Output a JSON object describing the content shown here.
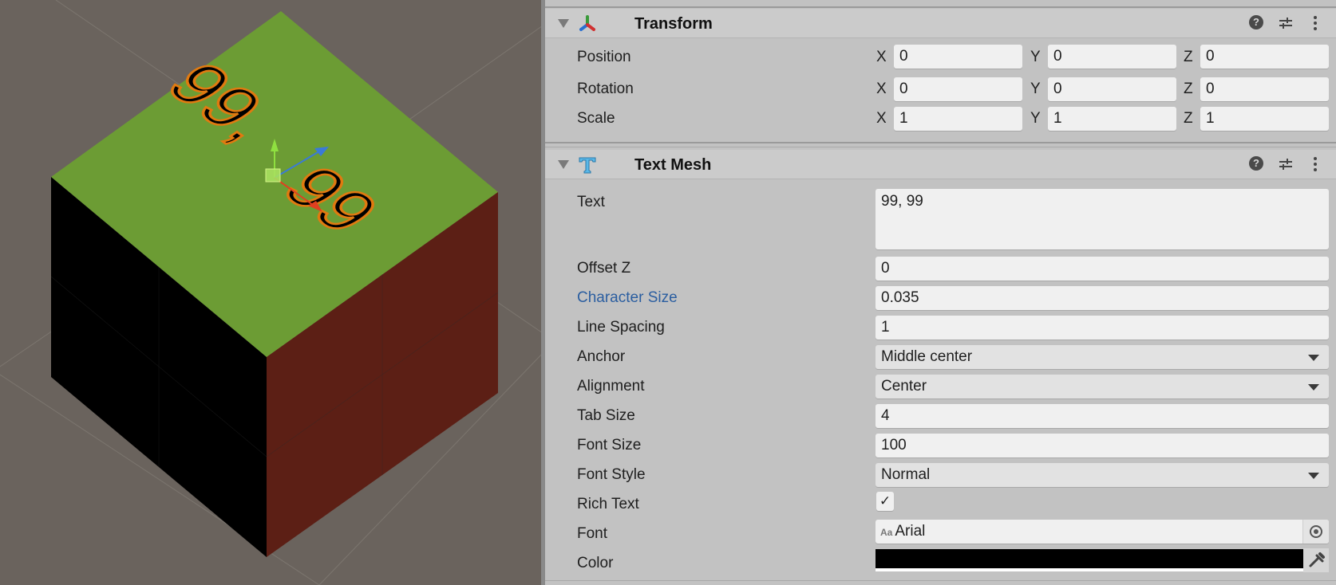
{
  "scene": {
    "label_text": "99, 99",
    "colors": {
      "background": "#6a635d",
      "top_face": "#6c9c34",
      "left_face": "#000000",
      "right_face": "#5c1f15",
      "text_outline": "#e07a10",
      "gizmo_x": "#e04020",
      "gizmo_y": "#8fe040",
      "gizmo_z": "#3a7ad8"
    }
  },
  "inspector": {
    "transform": {
      "title": "Transform",
      "icon": "transform-axes-icon",
      "rows": [
        {
          "label": "Position",
          "x": "0",
          "y": "0",
          "z": "0"
        },
        {
          "label": "Rotation",
          "x": "0",
          "y": "0",
          "z": "0"
        },
        {
          "label": "Scale",
          "x": "1",
          "y": "1",
          "z": "1"
        }
      ],
      "axis_labels": {
        "x": "X",
        "y": "Y",
        "z": "Z"
      }
    },
    "text_mesh": {
      "title": "Text Mesh",
      "icon": "text-mesh-icon",
      "text": {
        "label": "Text",
        "value": "99, 99"
      },
      "offset_z": {
        "label": "Offset Z",
        "value": "0"
      },
      "character_size": {
        "label": "Character Size",
        "value": "0.035"
      },
      "line_spacing": {
        "label": "Line Spacing",
        "value": "1"
      },
      "anchor": {
        "label": "Anchor",
        "value": "Middle center"
      },
      "alignment": {
        "label": "Alignment",
        "value": "Center"
      },
      "tab_size": {
        "label": "Tab Size",
        "value": "4"
      },
      "font_size": {
        "label": "Font Size",
        "value": "100"
      },
      "font_style": {
        "label": "Font Style",
        "value": "Normal"
      },
      "rich_text": {
        "label": "Rich Text",
        "checked": true,
        "check_glyph": "✓"
      },
      "font": {
        "label": "Font",
        "value": "Arial",
        "icon_text": "Aa"
      },
      "color": {
        "label": "Color",
        "value": "#000000"
      }
    },
    "header_buttons": {
      "help": "?"
    },
    "accent_label_color": "#2b5ea0"
  }
}
